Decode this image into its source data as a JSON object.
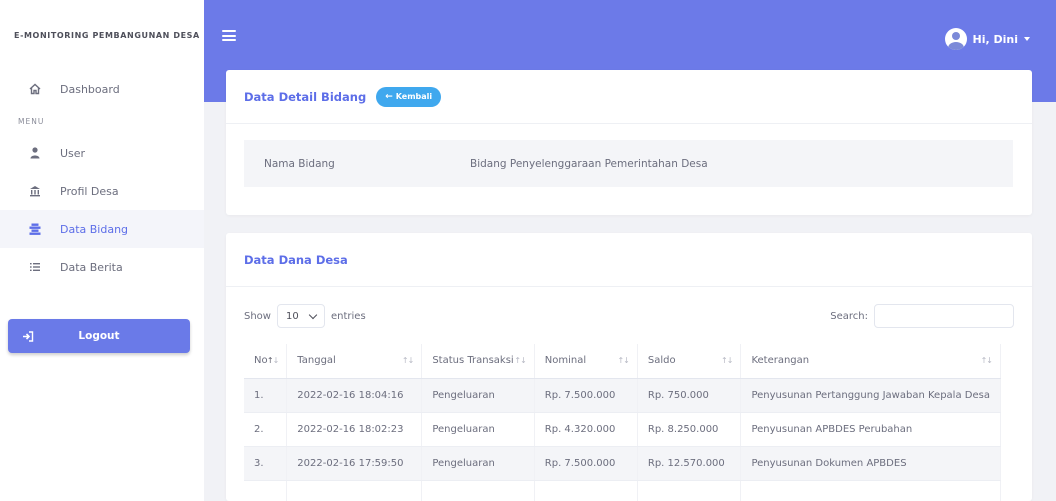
{
  "app": {
    "title": "E-MONITORING PEMBANGUNAN DESA"
  },
  "sidebar": {
    "dashboard": "Dashboard",
    "menu_heading": "MENU",
    "items": [
      {
        "label": "User",
        "icon": "user-icon"
      },
      {
        "label": "Profil Desa",
        "icon": "landmark-icon"
      },
      {
        "label": "Data Bidang",
        "icon": "list-icon",
        "active": true
      },
      {
        "label": "Data Berita",
        "icon": "list-lines-icon"
      }
    ],
    "logout": "Logout"
  },
  "topbar": {
    "user_greeting": "Hi, Dini"
  },
  "detail_card": {
    "title": "Data Detail Bidang",
    "back_label": "Kembali",
    "field_label": "Nama Bidang",
    "field_value": "Bidang Penyelenggaraan Pemerintahan Desa"
  },
  "dana_card": {
    "title": "Data Dana Desa",
    "show_label": "Show",
    "entries_value": "10",
    "entries_label": "entries",
    "search_label": "Search:",
    "columns": [
      "No",
      "Tanggal",
      "Status Transaksi",
      "Nominal",
      "Saldo",
      "Keterangan"
    ],
    "rows": [
      [
        "1.",
        "2022-02-16 18:04:16",
        "Pengeluaran",
        "Rp. 7.500.000",
        "Rp. 750.000",
        "Penyusunan Pertanggung Jawaban Kepala Desa"
      ],
      [
        "2.",
        "2022-02-16 18:02:23",
        "Pengeluaran",
        "Rp. 4.320.000",
        "Rp. 8.250.000",
        "Penyusunan APBDES Perubahan"
      ],
      [
        "3.",
        "2022-02-16 17:59:50",
        "Pengeluaran",
        "Rp. 7.500.000",
        "Rp. 12.570.000",
        "Penyusunan Dokumen APBDES"
      ]
    ]
  },
  "colors": {
    "accent": "#6c7ae8",
    "button": "#3fa8ee",
    "link": "#5d6ee8"
  }
}
